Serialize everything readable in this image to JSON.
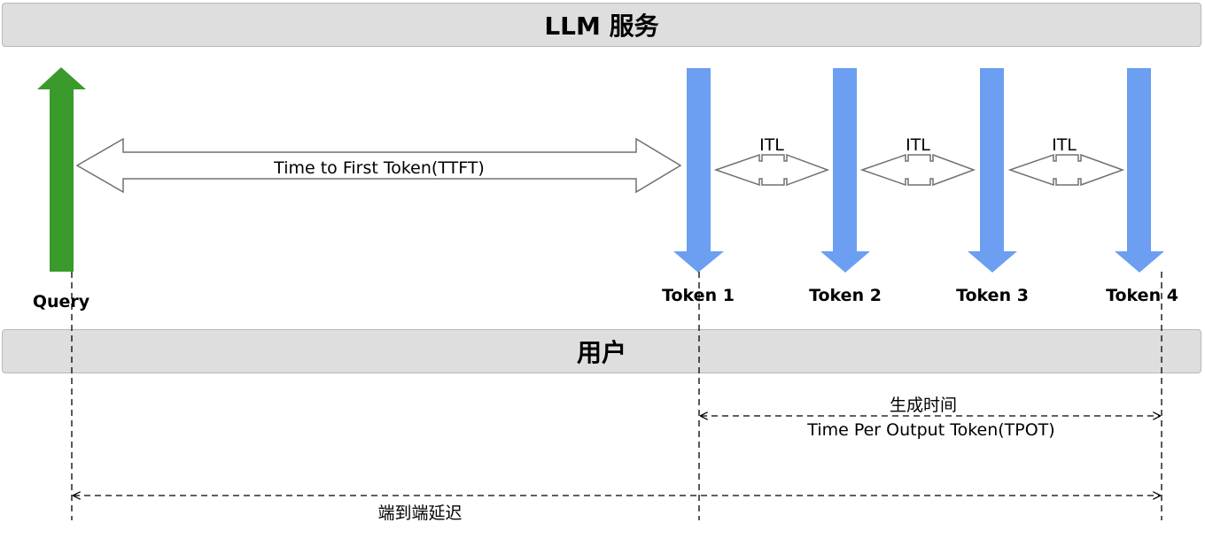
{
  "service_banner": {
    "label": "LLM 服务"
  },
  "user_banner": {
    "label": "用户"
  },
  "query_label": "Query",
  "tokens": [
    {
      "label": "Token 1"
    },
    {
      "label": "Token 2"
    },
    {
      "label": "Token 3"
    },
    {
      "label": "Token 4"
    }
  ],
  "ttft_label": "Time to First Token(TTFT)",
  "itl_labels": [
    "ITL",
    "ITL",
    "ITL"
  ],
  "generation_time_label": "生成时间",
  "tpot_label": "Time Per Output Token(TPOT)",
  "e2e_label": "端到端延迟",
  "colors": {
    "query_arrow": "#3a9a2b",
    "token_arrow": "#6c9ef2",
    "banner_fill": "#dedede",
    "banner_border": "#b9b9b9",
    "outline_arrow": "#707070"
  }
}
